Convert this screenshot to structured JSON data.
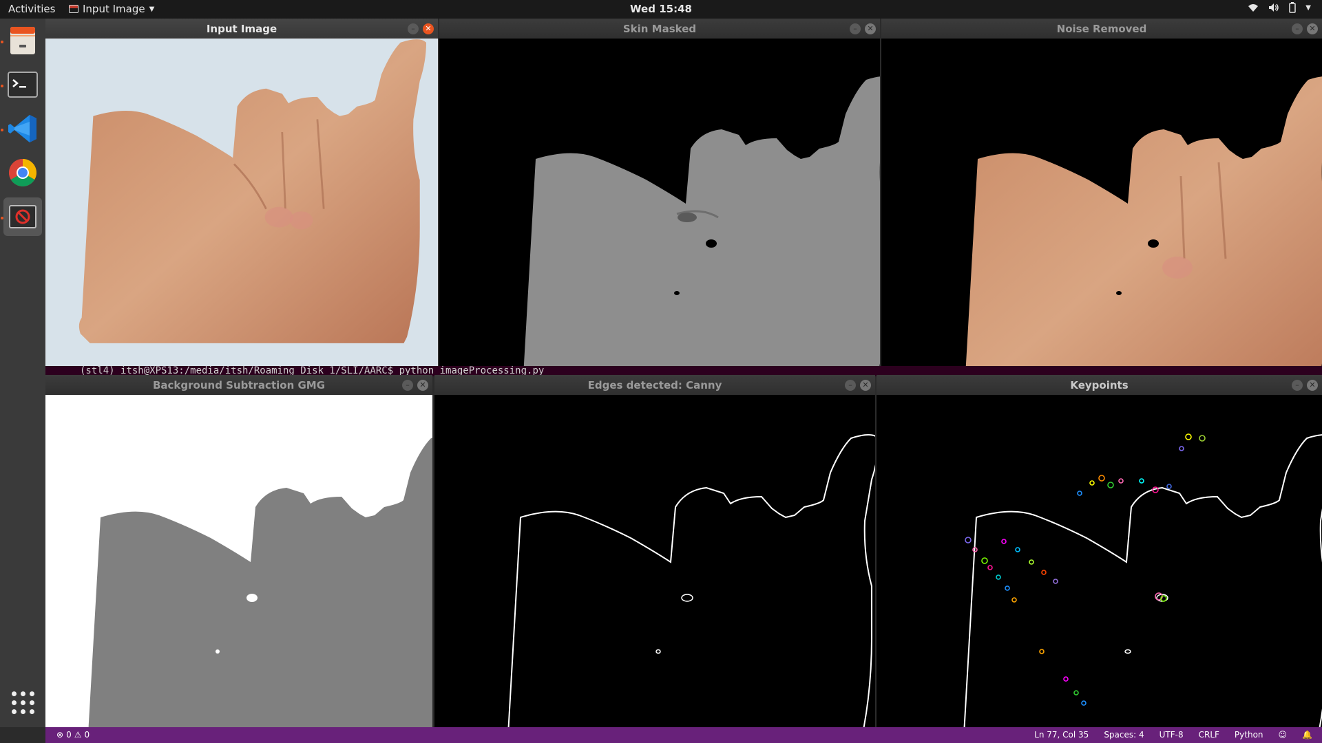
{
  "topbar": {
    "activities": "Activities",
    "app_menu": "Input Image",
    "clock": "Wed 15:48"
  },
  "dock": {
    "items": [
      {
        "name": "files",
        "icon": "file-cabinet-icon",
        "running": true
      },
      {
        "name": "terminal",
        "icon": "terminal-icon",
        "running": true
      },
      {
        "name": "vscode",
        "icon": "vscode-icon",
        "running": true
      },
      {
        "name": "chrome",
        "icon": "chrome-icon",
        "running": false
      },
      {
        "name": "image-viewer",
        "icon": "no-entry-icon",
        "running": true
      }
    ]
  },
  "windows": {
    "input_image": {
      "title": "Input Image"
    },
    "skin_masked": {
      "title": "Skin Masked"
    },
    "noise_removed": {
      "title": "Noise Removed"
    },
    "background_subtraction": {
      "title": "Background Subtraction GMG"
    },
    "edges": {
      "title": "Edges detected: Canny"
    },
    "keypoints": {
      "title": "Keypoints"
    }
  },
  "terminal": {
    "line": "(stl4) itsh@XPS13:/media/itsh/Roaming Disk 1/SLI/AARC$ python imageProcessing.py"
  },
  "statusbar": {
    "errors": "0",
    "warnings": "0",
    "position": "Ln 77, Col 35",
    "spaces": "Spaces: 4",
    "encoding": "UTF-8",
    "line_ending": "CRLF",
    "language": "Python"
  },
  "colors": {
    "ubuntu_orange": "#e95420",
    "statusbar_purple": "#68217a",
    "terminal_bg": "#2c001e",
    "mask_gray": "#808080"
  }
}
